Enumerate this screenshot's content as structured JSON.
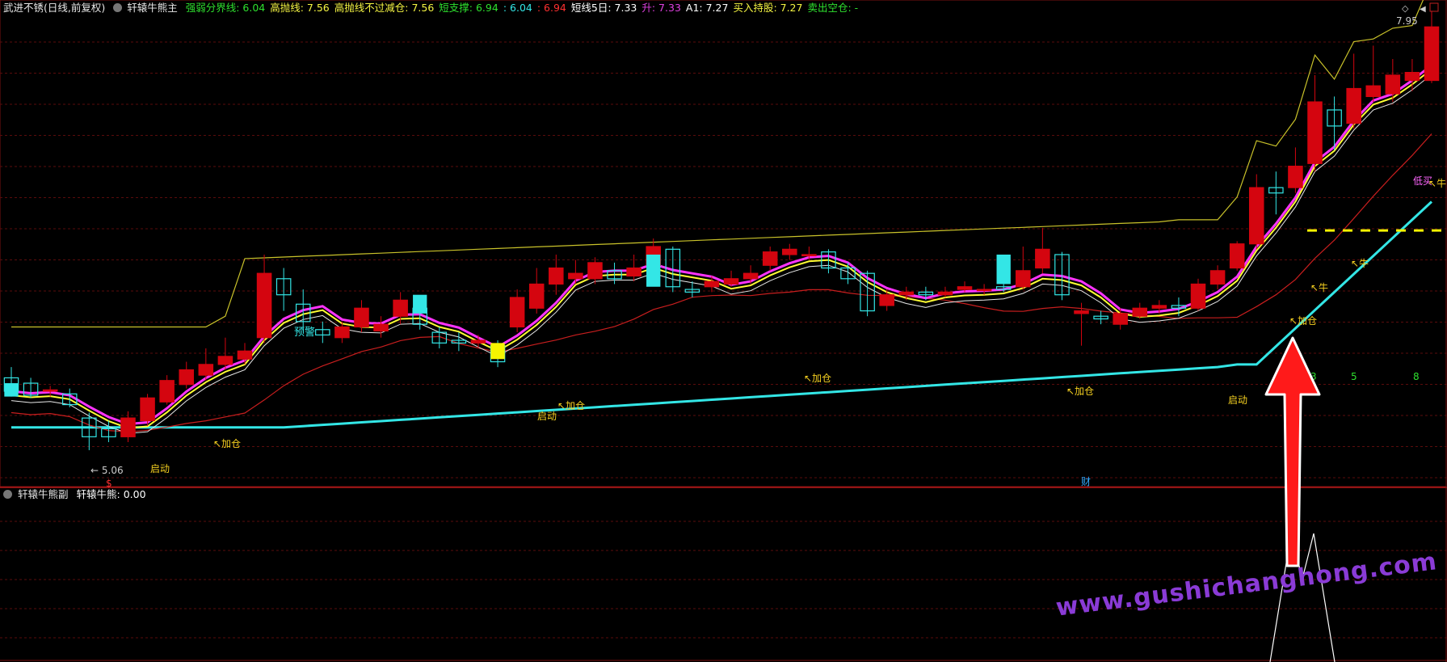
{
  "header": {
    "stock": "武进不锈(日线,前复权)",
    "indicator": "轩辕牛熊主",
    "items": [
      {
        "label": "强弱分界线:",
        "value": "6.04",
        "color": "#2ee02e"
      },
      {
        "label": "高抛线:",
        "value": "7.56",
        "color": "#f5f542"
      },
      {
        "label": "高抛线不过减仓:",
        "value": "7.56",
        "color": "#f5f542"
      },
      {
        "label": "短支撑:",
        "value": "6.94",
        "color": "#2ee02e"
      },
      {
        "label": ":",
        "value": "6.04",
        "color": "#33e6e6"
      },
      {
        "label": ":",
        "value": "6.94",
        "color": "#ff3030"
      },
      {
        "label": "短线5日:",
        "value": "7.33",
        "color": "#ffffff"
      },
      {
        "label": "升:",
        "value": "7.33",
        "color": "#e040e0"
      },
      {
        "label": "A1:",
        "value": "7.27",
        "color": "#ffffff"
      },
      {
        "label": "买入持股:",
        "value": "7.27",
        "color": "#f5f542"
      },
      {
        "label": "卖出空仓:",
        "value": "-",
        "color": "#2ee02e"
      }
    ]
  },
  "sub_header": {
    "indicator": "轩辕牛熊副",
    "label": "轩辕牛熊:",
    "value": "0.00"
  },
  "watermark": "www.gushichanghong.com",
  "colors": {
    "up": "#d4050f",
    "down": "#33e6e6",
    "grid": "#5a0c0c",
    "upper_band": "#c9c22a",
    "lower_band": "#33e6e6",
    "ma_magenta": "#ff33ff",
    "ma_yellow": "#ffff33",
    "ma_red": "#c81e1e",
    "signal_text": "#f5d020",
    "arrow": "#ff1a1a"
  },
  "chart_data": {
    "type": "candlestick",
    "price_range": [
      4.8,
      8.3
    ],
    "high_label": "7.95",
    "low_label": "5.06",
    "candles": [
      [
        5.6,
        5.5,
        5.68,
        5.46
      ],
      [
        5.56,
        5.47,
        5.6,
        5.45
      ],
      [
        5.5,
        5.51,
        5.54,
        5.46
      ],
      [
        5.48,
        5.4,
        5.52,
        5.38
      ],
      [
        5.3,
        5.16,
        5.34,
        5.06
      ],
      [
        5.22,
        5.16,
        5.28,
        5.12
      ],
      [
        5.16,
        5.3,
        5.35,
        5.12
      ],
      [
        5.28,
        5.45,
        5.48,
        5.24
      ],
      [
        5.42,
        5.58,
        5.62,
        5.4
      ],
      [
        5.55,
        5.66,
        5.72,
        5.52
      ],
      [
        5.62,
        5.7,
        5.82,
        5.58
      ],
      [
        5.7,
        5.76,
        5.9,
        5.66
      ],
      [
        5.74,
        5.8,
        5.86,
        5.7
      ],
      [
        5.9,
        6.38,
        6.52,
        5.86
      ],
      [
        6.34,
        6.22,
        6.42,
        6.1
      ],
      [
        6.15,
        6.02,
        6.26,
        5.95
      ],
      [
        5.96,
        5.92,
        6.02,
        5.86
      ],
      [
        5.9,
        5.98,
        6.02,
        5.86
      ],
      [
        5.98,
        6.12,
        6.18,
        5.94
      ],
      [
        5.95,
        6.0,
        6.06,
        5.9
      ],
      [
        6.06,
        6.18,
        6.24,
        6.0
      ],
      [
        6.12,
        6.0,
        6.16,
        5.96
      ],
      [
        5.94,
        5.86,
        5.98,
        5.82
      ],
      [
        5.88,
        5.86,
        5.94,
        5.8
      ],
      [
        5.86,
        5.88,
        5.92,
        5.82
      ],
      [
        5.84,
        5.72,
        5.88,
        5.68
      ],
      [
        5.98,
        6.2,
        6.26,
        5.94
      ],
      [
        6.12,
        6.3,
        6.42,
        6.08
      ],
      [
        6.3,
        6.42,
        6.52,
        6.22
      ],
      [
        6.34,
        6.38,
        6.48,
        6.3
      ],
      [
        6.34,
        6.46,
        6.5,
        6.3
      ],
      [
        6.4,
        6.34,
        6.46,
        6.3
      ],
      [
        6.36,
        6.42,
        6.52,
        6.32
      ],
      [
        6.44,
        6.58,
        6.64,
        6.4
      ],
      [
        6.56,
        6.28,
        6.58,
        6.24
      ],
      [
        6.26,
        6.24,
        6.32,
        6.2
      ],
      [
        6.28,
        6.32,
        6.36,
        6.24
      ],
      [
        6.3,
        6.34,
        6.4,
        6.28
      ],
      [
        6.34,
        6.38,
        6.44,
        6.3
      ],
      [
        6.44,
        6.54,
        6.58,
        6.4
      ],
      [
        6.52,
        6.56,
        6.6,
        6.48
      ],
      [
        6.52,
        6.52,
        6.58,
        6.48
      ],
      [
        6.54,
        6.42,
        6.56,
        6.38
      ],
      [
        6.42,
        6.34,
        6.46,
        6.3
      ],
      [
        6.38,
        6.1,
        6.4,
        6.06
      ],
      [
        6.14,
        6.22,
        6.26,
        6.1
      ],
      [
        6.22,
        6.24,
        6.28,
        6.18
      ],
      [
        6.24,
        6.22,
        6.28,
        6.18
      ],
      [
        6.22,
        6.24,
        6.28,
        6.2
      ],
      [
        6.26,
        6.28,
        6.32,
        6.24
      ],
      [
        6.26,
        6.26,
        6.3,
        6.22
      ],
      [
        6.28,
        6.26,
        6.3,
        6.24
      ],
      [
        6.28,
        6.4,
        6.58,
        6.26
      ],
      [
        6.42,
        6.56,
        6.72,
        6.38
      ],
      [
        6.52,
        6.22,
        6.54,
        6.18
      ],
      [
        6.08,
        6.1,
        6.16,
        5.84
      ],
      [
        6.06,
        6.04,
        6.1,
        6.0
      ],
      [
        6.0,
        6.08,
        6.12,
        5.96
      ],
      [
        6.06,
        6.12,
        6.16,
        6.04
      ],
      [
        6.12,
        6.14,
        6.18,
        6.08
      ],
      [
        6.14,
        6.12,
        6.2,
        6.06
      ],
      [
        6.12,
        6.3,
        6.34,
        6.1
      ],
      [
        6.3,
        6.4,
        6.44,
        6.26
      ],
      [
        6.42,
        6.6,
        6.62,
        6.4
      ],
      [
        6.6,
        7.02,
        7.12,
        6.56
      ],
      [
        7.02,
        6.98,
        7.14,
        6.82
      ],
      [
        7.02,
        7.18,
        7.32,
        6.98
      ],
      [
        7.2,
        7.66,
        7.86,
        7.14
      ],
      [
        7.6,
        7.48,
        7.7,
        7.3
      ],
      [
        7.5,
        7.76,
        8.02,
        7.46
      ],
      [
        7.7,
        7.78,
        8.08,
        7.66
      ],
      [
        7.72,
        7.86,
        7.98,
        7.66
      ],
      [
        7.82,
        7.88,
        7.98,
        7.74
      ],
      [
        7.82,
        8.22,
        8.34,
        7.8
      ]
    ],
    "axis_labels": [
      "3",
      "5",
      "8"
    ],
    "annotations": [
      "预警",
      "加仓",
      "启动",
      "牛",
      "低买",
      "财",
      "$"
    ],
    "sub_panel": {
      "label": "轩辕牛熊",
      "value": 0.0
    }
  }
}
